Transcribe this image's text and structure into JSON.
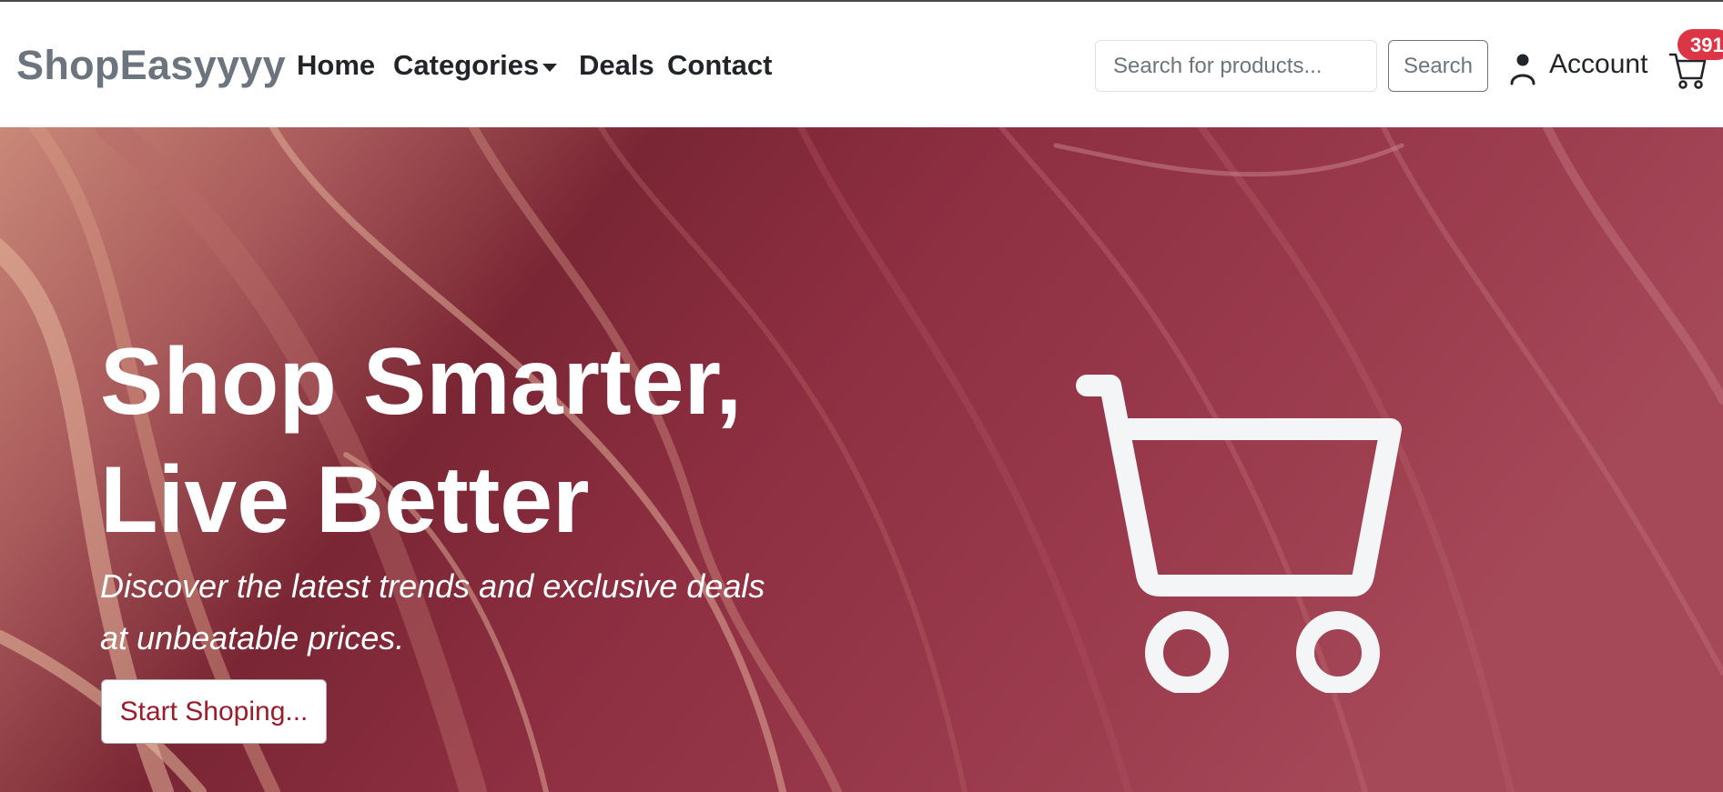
{
  "navbar": {
    "brand": "ShopEasyyyy",
    "links": [
      {
        "label": "Home"
      },
      {
        "label": "Categories"
      },
      {
        "label": "Deals"
      },
      {
        "label": "Contact"
      }
    ],
    "search": {
      "placeholder": "Search for products...",
      "value": "",
      "button_label": "Search"
    },
    "account_label": "Account",
    "cart_count": "391"
  },
  "hero": {
    "title_line1": "Shop Smarter,",
    "title_line2": "Live Better",
    "subtitle": "Discover the latest trends and exclusive deals at unbeatable prices.",
    "cta_label": "Start Shoping...",
    "colors": {
      "background": "#8c3040",
      "cta_text": "#9b1c2b"
    }
  },
  "colors": {
    "badge": "#dc3545",
    "brand": "#6c757d"
  },
  "icons": [
    "person-icon",
    "cart-icon",
    "caret-down-icon",
    "hero-cart-icon"
  ]
}
